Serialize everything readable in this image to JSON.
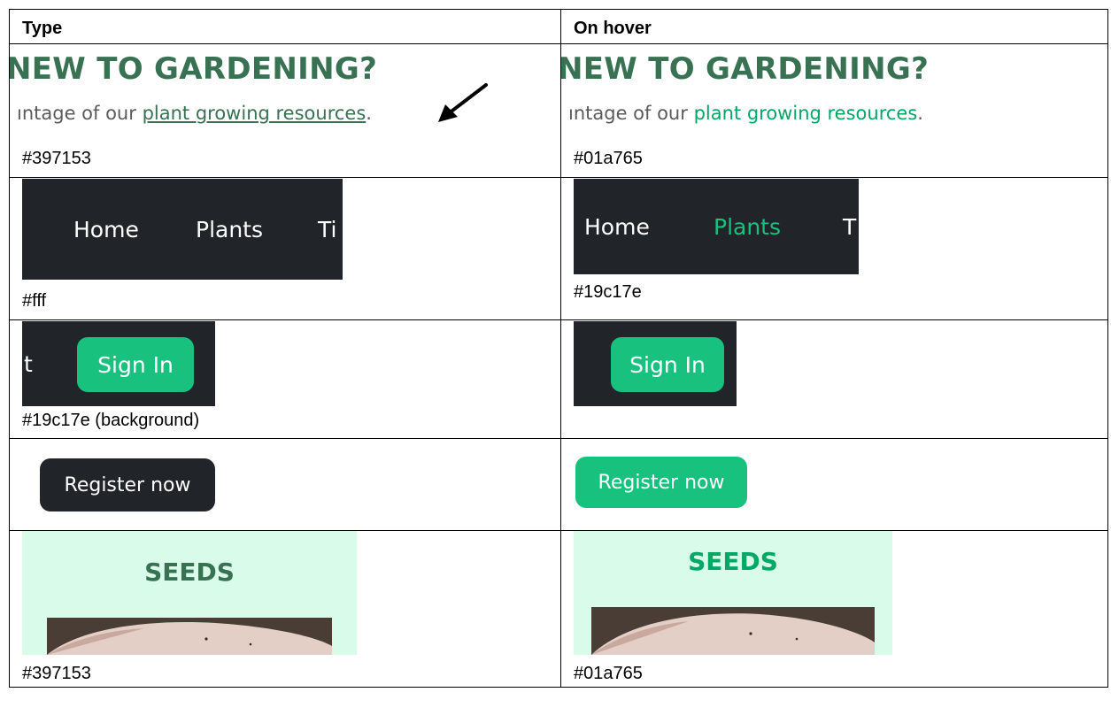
{
  "table": {
    "col1_header": "Type",
    "col2_header": "On hover"
  },
  "rows": [
    {
      "heading": "NEW TO GARDENING?",
      "text_before": "ıntage of our",
      "link": "plant growing resources",
      "text_after": ".",
      "type_color": "#397153",
      "hover_color": "#01a765"
    },
    {
      "nav_items": [
        "Home",
        "Plants",
        "Ti"
      ],
      "hover_nav_items": [
        "Home",
        "Plants",
        "T"
      ],
      "type_color": "#fff",
      "hover_color": "#19c17e"
    },
    {
      "left_fragment": "t",
      "button": "Sign In",
      "type_caption": "#19c17e (background)"
    },
    {
      "button": "Register now",
      "type_bg": "#212529",
      "hover_bg": "#19c17e"
    },
    {
      "title": "SEEDS",
      "type_color": "#397153",
      "hover_color": "#01a765"
    }
  ]
}
